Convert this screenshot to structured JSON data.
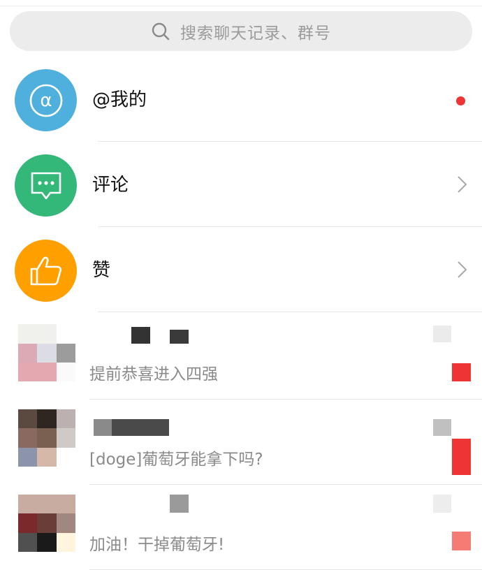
{
  "search": {
    "placeholder": "搜索聊天记录、群号",
    "icon": "search-icon"
  },
  "notifications": [
    {
      "label": "@我的",
      "icon": "at-icon",
      "color": "#4fb0dd",
      "indicator": "red-dot"
    },
    {
      "label": "评论",
      "icon": "comment-bubble-icon",
      "color": "#33b87a",
      "indicator": "chevron"
    },
    {
      "label": "赞",
      "icon": "thumbs-up-icon",
      "color": "#ff9f00",
      "indicator": "chevron"
    }
  ],
  "conversations": [
    {
      "preview": "提前恭喜进入四强"
    },
    {
      "preview": "[doge]葡萄牙能拿下吗?"
    },
    {
      "preview": "加油！干掉葡萄牙!"
    }
  ],
  "colors": {
    "red_badge": "#ef3434",
    "separator": "#e6e6e6",
    "search_bg": "#ececec"
  }
}
